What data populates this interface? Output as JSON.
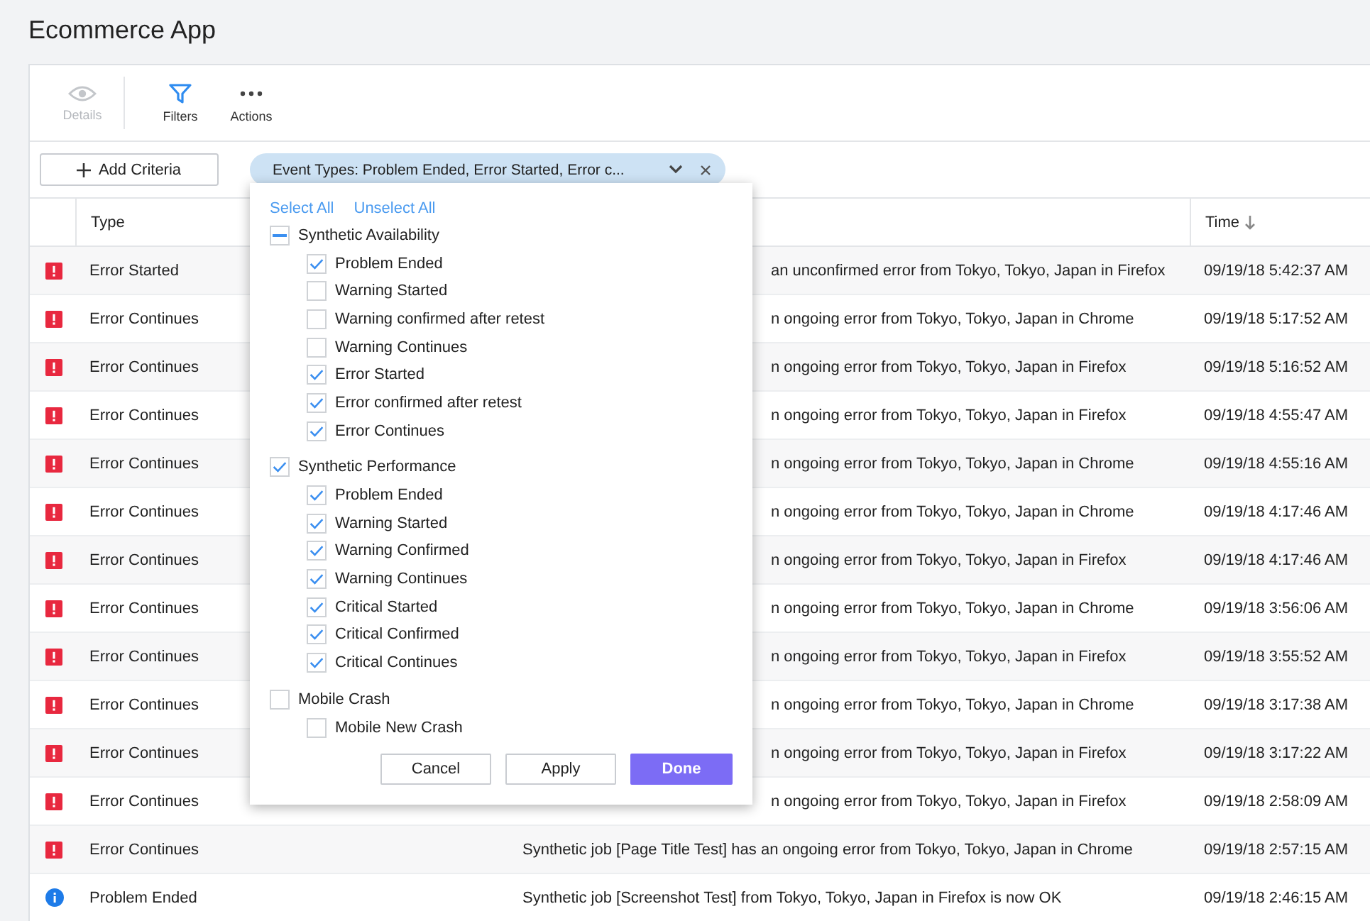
{
  "page_title": "Ecommerce App",
  "toolbar": [
    {
      "label": "Details",
      "disabled": true
    },
    {
      "label": "Filters",
      "disabled": false
    },
    {
      "label": "Actions",
      "disabled": false
    }
  ],
  "add_criteria": {
    "label": "Add Criteria"
  },
  "filter_chip": {
    "label": "Event Types: Problem Ended, Error Started, Error c..."
  },
  "table": {
    "columns": [
      {
        "label": "Type"
      },
      {
        "label": "Time",
        "sorted": true
      }
    ],
    "rows": [
      {
        "kind": "error",
        "type": "Error Started",
        "description": "an unconfirmed error from Tokyo, Tokyo, Japan in Firefox",
        "clipped": true,
        "time": "09/19/18 5:42:37 AM"
      },
      {
        "kind": "error",
        "type": "Error Continues",
        "description": "n ongoing error from Tokyo, Tokyo, Japan in Chrome",
        "clipped": true,
        "time": "09/19/18 5:17:52 AM"
      },
      {
        "kind": "error",
        "type": "Error Continues",
        "description": "n ongoing error from Tokyo, Tokyo, Japan in Firefox",
        "clipped": true,
        "time": "09/19/18 5:16:52 AM"
      },
      {
        "kind": "error",
        "type": "Error Continues",
        "description": "n ongoing error from Tokyo, Tokyo, Japan in Firefox",
        "clipped": true,
        "time": "09/19/18 4:55:47 AM"
      },
      {
        "kind": "error",
        "type": "Error Continues",
        "description": "n ongoing error from Tokyo, Tokyo, Japan in Chrome",
        "clipped": true,
        "time": "09/19/18 4:55:16 AM"
      },
      {
        "kind": "error",
        "type": "Error Continues",
        "description": "n ongoing error from Tokyo, Tokyo, Japan in Chrome",
        "clipped": true,
        "time": "09/19/18 4:17:46 AM"
      },
      {
        "kind": "error",
        "type": "Error Continues",
        "description": "n ongoing error from Tokyo, Tokyo, Japan in Firefox",
        "clipped": true,
        "time": "09/19/18 4:17:46 AM"
      },
      {
        "kind": "error",
        "type": "Error Continues",
        "description": "n ongoing error from Tokyo, Tokyo, Japan in Chrome",
        "clipped": true,
        "time": "09/19/18 3:56:06 AM"
      },
      {
        "kind": "error",
        "type": "Error Continues",
        "description": "n ongoing error from Tokyo, Tokyo, Japan in Firefox",
        "clipped": true,
        "time": "09/19/18 3:55:52 AM"
      },
      {
        "kind": "error",
        "type": "Error Continues",
        "description": "n ongoing error from Tokyo, Tokyo, Japan in Chrome",
        "clipped": true,
        "time": "09/19/18 3:17:38 AM"
      },
      {
        "kind": "error",
        "type": "Error Continues",
        "description": "n ongoing error from Tokyo, Tokyo, Japan in Firefox",
        "clipped": true,
        "time": "09/19/18 3:17:22 AM"
      },
      {
        "kind": "error",
        "type": "Error Continues",
        "description": "n ongoing error from Tokyo, Tokyo, Japan in Firefox",
        "clipped": true,
        "time": "09/19/18 2:58:09 AM"
      },
      {
        "kind": "error",
        "type": "Error Continues",
        "description": "Synthetic job [Page Title Test] has an ongoing error from Tokyo, Tokyo, Japan in Chrome",
        "clipped": false,
        "time": "09/19/18 2:57:15 AM"
      },
      {
        "kind": "info",
        "type": "Problem Ended",
        "description": "Synthetic job [Screenshot Test] from Tokyo, Tokyo, Japan in Firefox is now OK",
        "clipped": false,
        "time": "09/19/18 2:46:15 AM"
      }
    ]
  },
  "popup": {
    "links": [
      "Select All",
      "Unselect All"
    ],
    "groups": [
      {
        "label": "Synthetic Availability",
        "checked": false,
        "partial": true,
        "items": [
          {
            "label": "Problem Ended",
            "checked": true
          },
          {
            "label": "Warning Started",
            "checked": false
          },
          {
            "label": "Warning confirmed after retest",
            "checked": false
          },
          {
            "label": "Warning Continues",
            "checked": false
          },
          {
            "label": "Error Started",
            "checked": true
          },
          {
            "label": "Error confirmed after retest",
            "checked": true
          },
          {
            "label": "Error Continues",
            "checked": true
          }
        ]
      },
      {
        "label": "Synthetic Performance",
        "checked": true,
        "partial": false,
        "items": [
          {
            "label": "Problem Ended",
            "checked": true
          },
          {
            "label": "Warning Started",
            "checked": true
          },
          {
            "label": "Warning Confirmed",
            "checked": true
          },
          {
            "label": "Warning Continues",
            "checked": true
          },
          {
            "label": "Critical Started",
            "checked": true
          },
          {
            "label": "Critical Confirmed",
            "checked": true
          },
          {
            "label": "Critical Continues",
            "checked": true
          }
        ]
      },
      {
        "label": "Mobile Crash",
        "checked": false,
        "partial": false,
        "items": [
          {
            "label": "Mobile New Crash",
            "checked": false
          }
        ]
      }
    ],
    "buttons": [
      {
        "label": "Cancel",
        "kind": "secondary"
      },
      {
        "label": "Apply",
        "kind": "secondary"
      },
      {
        "label": "Done",
        "kind": "primary"
      }
    ]
  }
}
